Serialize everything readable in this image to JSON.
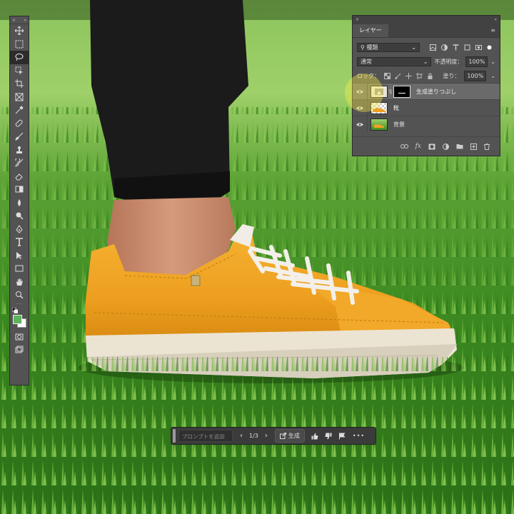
{
  "toolbar": {
    "tools": [
      "move-icon",
      "marquee-icon",
      "lasso-icon",
      "object-select-icon",
      "crop-icon",
      "frame-icon",
      "eyedropper-icon",
      "healing-brush-icon",
      "brush-icon",
      "clone-stamp-icon",
      "history-brush-icon",
      "eraser-icon",
      "gradient-icon",
      "blur-icon",
      "dodge-icon",
      "pen-icon",
      "type-icon",
      "path-select-icon",
      "rectangle-icon",
      "hand-icon",
      "zoom-icon"
    ],
    "active_tool": "lasso-icon",
    "foreground_color": "#5fb35b",
    "background_color": "#ffffff"
  },
  "layers_panel": {
    "tab_label": "レイヤー",
    "filter_select": "種類",
    "blend_mode": "通常",
    "opacity_label": "不透明度：",
    "opacity_value": "100%",
    "lock_label": "ロック：",
    "fill_label": "塗り：",
    "fill_value": "100%",
    "layers": [
      {
        "name": "生成塗りつぶし",
        "selected": true
      },
      {
        "name": "靴",
        "selected": false
      },
      {
        "name": "背景",
        "selected": false
      }
    ],
    "bottom_icons": [
      "link-icon",
      "fx-icon",
      "mask-icon",
      "adjustment-icon",
      "folder-icon",
      "new-layer-icon",
      "trash-icon"
    ],
    "fx_label": "fx"
  },
  "taskbar": {
    "prompt_placeholder": "プロンプトを追加",
    "counter": "1/3",
    "generate_label": "生成",
    "icons": [
      "thumbs-up-icon",
      "thumbs-down-icon",
      "flag-icon",
      "more-icon"
    ]
  },
  "colors": {
    "panel_bg": "#535353",
    "shoe": "#f0a124",
    "grass": "#3f8f22"
  }
}
